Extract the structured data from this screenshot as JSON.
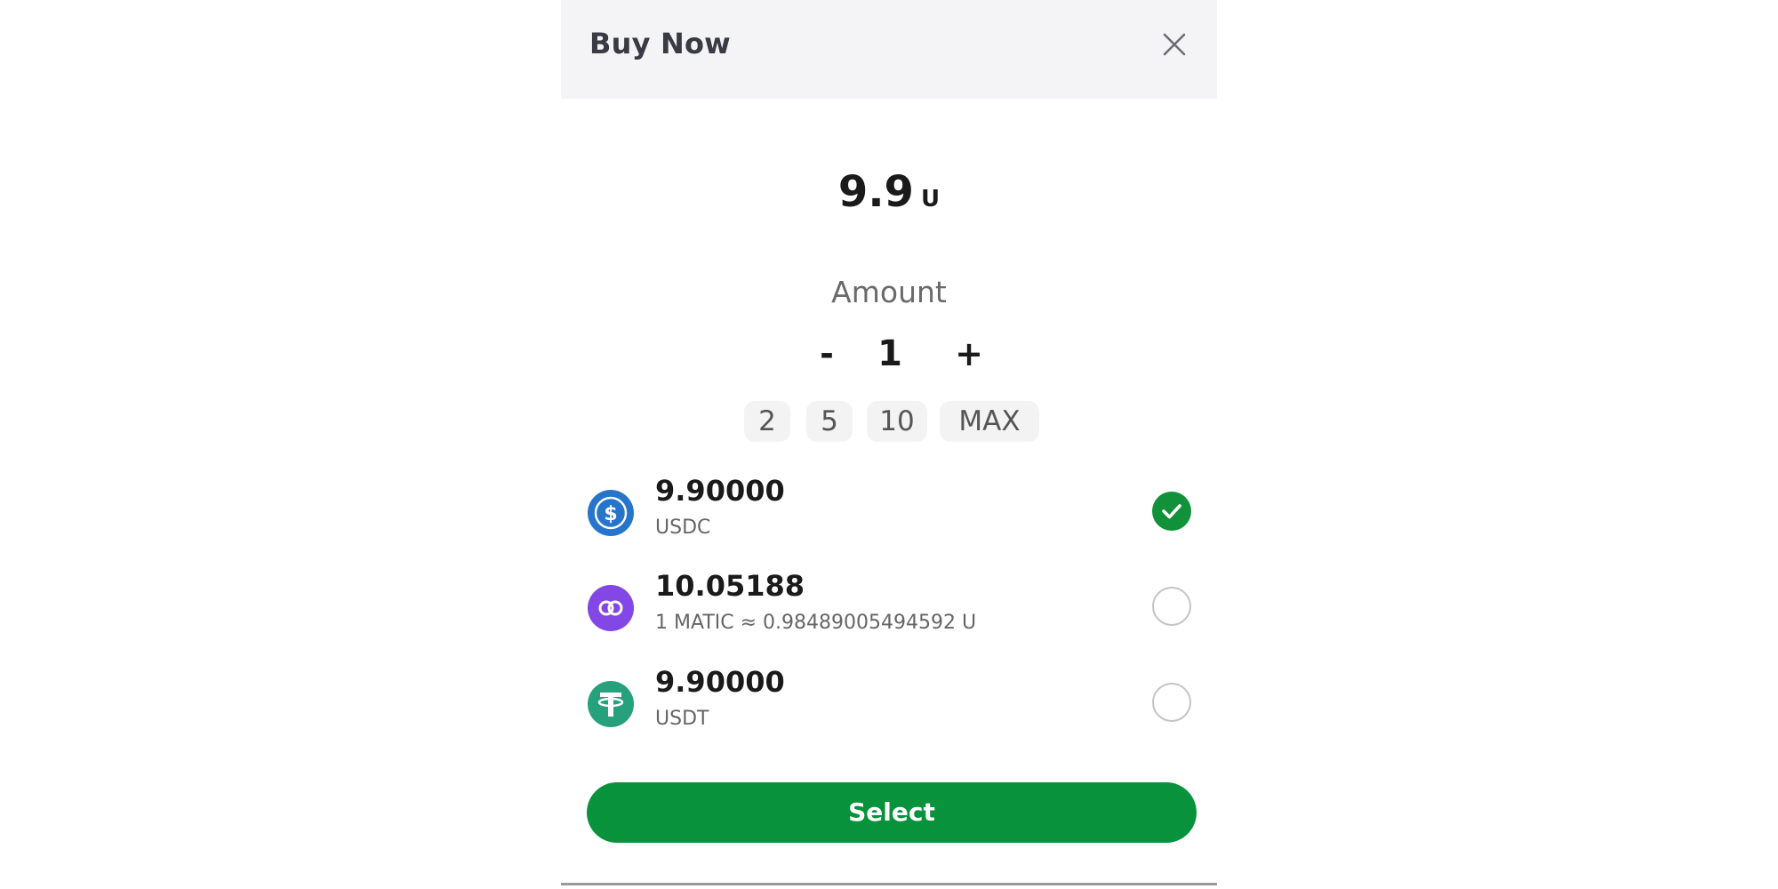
{
  "header": {
    "title": "Buy Now",
    "close_icon": "close-icon"
  },
  "price": {
    "value": "9.9",
    "unit": "U"
  },
  "amount": {
    "label": "Amount",
    "minus": "-",
    "value": "1",
    "plus": "+",
    "quick_options": [
      "2",
      "5",
      "10",
      "MAX"
    ]
  },
  "payment_options": [
    {
      "amount": "9.90000",
      "subtitle": "USDC",
      "icon": "usdc-icon",
      "selected": true
    },
    {
      "amount": "10.05188",
      "subtitle": "1 MATIC ≈ 0.98489005494592 U",
      "icon": "matic-icon",
      "selected": false
    },
    {
      "amount": "9.90000",
      "subtitle": "USDT",
      "icon": "usdt-icon",
      "selected": false
    }
  ],
  "select_button": "Select",
  "colors": {
    "accent_green": "#08923b",
    "usdc_blue": "#2775ca",
    "matic_purple": "#8247e5",
    "usdt_teal": "#26a17b",
    "header_bg": "#f4f4f6"
  }
}
